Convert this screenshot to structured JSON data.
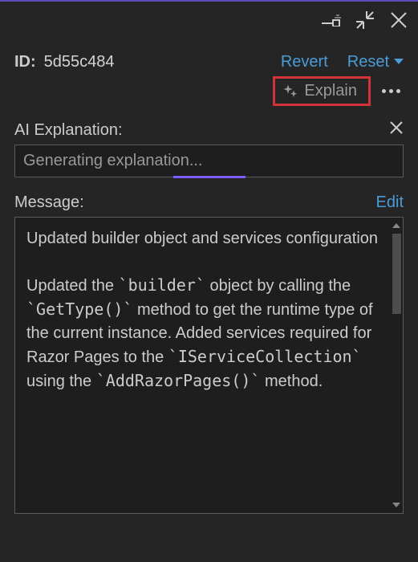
{
  "header": {
    "id_label": "ID:",
    "id_value": "5d55c484",
    "revert": "Revert",
    "reset": "Reset"
  },
  "explain": {
    "label": "Explain"
  },
  "ai_section": {
    "label": "AI Explanation:",
    "status": "Generating explanation..."
  },
  "message_section": {
    "label": "Message:",
    "edit": "Edit",
    "body": "Updated builder object and services configuration\n\nUpdated the `builder` object by calling the `GetType()` method to get the runtime type of the current instance. Added services required for Razor Pages to the `IServiceCollection` using the `AddRazorPages()` method."
  }
}
